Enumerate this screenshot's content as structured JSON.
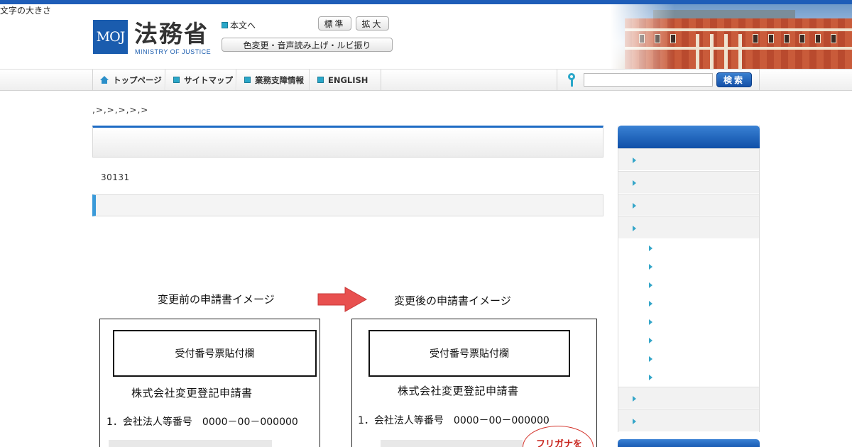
{
  "header": {
    "logo_mark": "MOJ",
    "logo_kanji": "法務省",
    "logo_en": "MINISTRY OF JUSTICE",
    "skip_link": "本文へ",
    "text_size_label": "文字の大きさ",
    "btn_standard": "標準",
    "btn_large": "拡大",
    "btn_accessibility": "色変更・音声読み上げ・ルビ振り"
  },
  "nav": {
    "home": "トップページ",
    "sitemap": "サイトマップ",
    "business": "業務支障情報",
    "english": "ENGLISH",
    "search_button": "検索",
    "search_value": ""
  },
  "breadcrumb": ",>,>,>,>,>",
  "main": {
    "date": "30131"
  },
  "illustration": {
    "caption_before": "変更前の申請書イメージ",
    "caption_after": "変更後の申請書イメージ",
    "receipt_label": "受付番号票貼付欄",
    "form_title": "株式会社変更登記申請書",
    "row_label": "1．会社法人等番号",
    "row_value": "0000－00－000000",
    "callout_text": "フリガナを",
    "arrow_color": "#e8504f"
  },
  "sidebar": {
    "items": 6,
    "subitems": 8
  },
  "colors": {
    "accent_blue": "#1e5db8",
    "icon_cyan": "#2aa7c9",
    "callout_red": "#d3322a"
  }
}
